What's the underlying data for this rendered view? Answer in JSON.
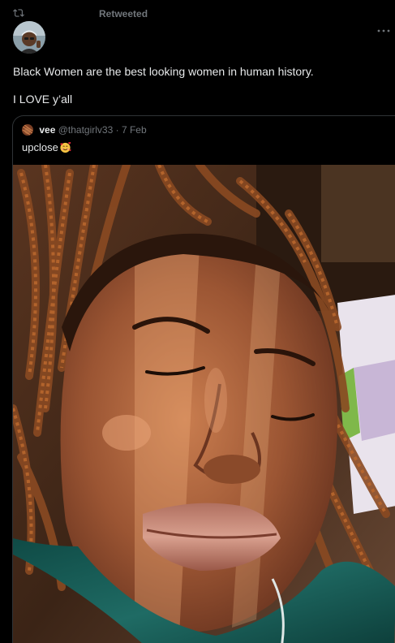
{
  "retweet": {
    "label": "Retweeted",
    "icon": "retweet-icon"
  },
  "post": {
    "lines": [
      "Black Women are the best looking women in human history.",
      "I LOVE y’all"
    ],
    "menu_icon": "more-horizontal-icon"
  },
  "quote": {
    "name": "vee",
    "handle": "@thatgirlv33",
    "separator": "·",
    "date": "7 Feb",
    "text": "upclose",
    "emoji": "smiling-face-with-hearts-emoji"
  },
  "colors": {
    "background": "#000000",
    "primary_text": "#e7e9ea",
    "secondary_text": "#71767b",
    "border": "#2f3336"
  }
}
